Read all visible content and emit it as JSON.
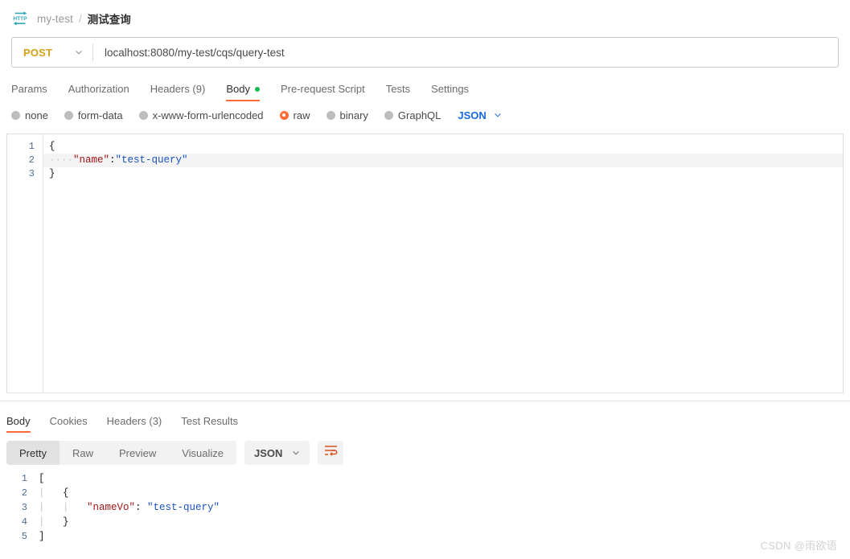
{
  "breadcrumb": {
    "icon": "http-protocol-icon",
    "parent": "my-test",
    "separator": "/",
    "current": "测试查询"
  },
  "request": {
    "method": "POST",
    "method_chevron": "chevron-down-icon",
    "url": "localhost:8080/my-test/cqs/query-test",
    "url_placeholder": "Enter request URL",
    "tabs": [
      {
        "label": "Params",
        "active": false,
        "dot": false
      },
      {
        "label": "Authorization",
        "active": false,
        "dot": false
      },
      {
        "label": "Headers (9)",
        "active": false,
        "dot": false
      },
      {
        "label": "Body",
        "active": true,
        "dot": true
      },
      {
        "label": "Pre-request Script",
        "active": false,
        "dot": false
      },
      {
        "label": "Tests",
        "active": false,
        "dot": false
      },
      {
        "label": "Settings",
        "active": false,
        "dot": false
      }
    ],
    "body_types": [
      {
        "label": "none",
        "selected": false
      },
      {
        "label": "form-data",
        "selected": false
      },
      {
        "label": "x-www-form-urlencoded",
        "selected": false
      },
      {
        "label": "raw",
        "selected": true
      },
      {
        "label": "binary",
        "selected": false
      },
      {
        "label": "GraphQL",
        "selected": false
      }
    ],
    "format": "JSON",
    "format_chevron": "chevron-down-icon",
    "editor": {
      "line_numbers": [
        "1",
        "2",
        "3"
      ],
      "lines": [
        {
          "indent_dots": "",
          "tokens": [
            {
              "text": "{",
              "type": "punc"
            }
          ],
          "highlighted": false
        },
        {
          "indent_dots": "····",
          "tokens": [
            {
              "text": "\"name\"",
              "type": "key"
            },
            {
              "text": ":",
              "type": "punc"
            },
            {
              "text": "\"test-query\"",
              "type": "str"
            }
          ],
          "highlighted": true
        },
        {
          "indent_dots": "",
          "tokens": [
            {
              "text": "}",
              "type": "punc"
            }
          ],
          "highlighted": false
        }
      ]
    }
  },
  "response": {
    "tabs": [
      {
        "label": "Body",
        "active": true
      },
      {
        "label": "Cookies",
        "active": false
      },
      {
        "label": "Headers (3)",
        "active": false
      },
      {
        "label": "Test Results",
        "active": false
      }
    ],
    "view_modes": [
      {
        "label": "Pretty",
        "active": true
      },
      {
        "label": "Raw",
        "active": false
      },
      {
        "label": "Preview",
        "active": false
      },
      {
        "label": "Visualize",
        "active": false
      }
    ],
    "format": "JSON",
    "format_chevron": "chevron-down-icon",
    "wrap_icon": "word-wrap-icon",
    "wrap_icon_color": "#d9501e",
    "body": {
      "line_numbers": [
        "1",
        "2",
        "3",
        "4",
        "5"
      ],
      "lines": [
        {
          "indent": 0,
          "tokens": [
            {
              "text": "[",
              "type": "punc"
            }
          ]
        },
        {
          "indent": 1,
          "tokens": [
            {
              "text": "{",
              "type": "punc"
            }
          ]
        },
        {
          "indent": 2,
          "tokens": [
            {
              "text": "\"nameVo\"",
              "type": "key"
            },
            {
              "text": ": ",
              "type": "punc"
            },
            {
              "text": "\"test-query\"",
              "type": "str"
            }
          ]
        },
        {
          "indent": 1,
          "tokens": [
            {
              "text": "}",
              "type": "punc"
            }
          ]
        },
        {
          "indent": 0,
          "tokens": [
            {
              "text": "]",
              "type": "punc"
            }
          ]
        }
      ]
    }
  },
  "watermark": "CSDN @雨欲语",
  "colors": {
    "accent_orange": "#ff6c37",
    "method_post": "#d4a017",
    "dot_green": "#0cbb52",
    "json_blue": "#1668dc",
    "json_key": "#a31515",
    "json_string": "#1a51c4",
    "line_number": "#4f6d8f"
  }
}
